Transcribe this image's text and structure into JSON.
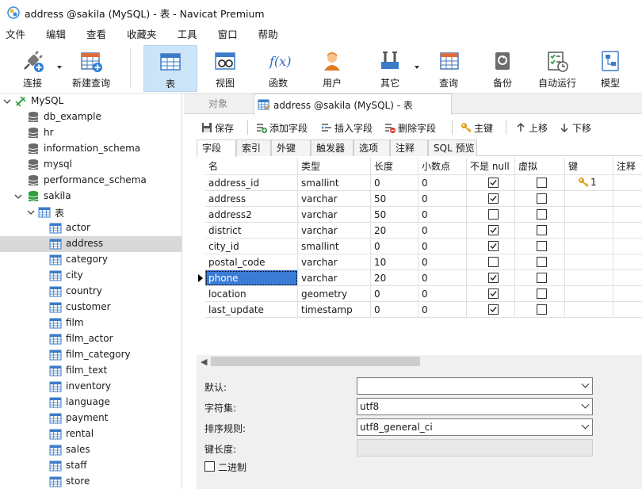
{
  "window": {
    "title": "address @sakila (MySQL) - 表 - Navicat Premium"
  },
  "menu": [
    "文件",
    "编辑",
    "查看",
    "收藏夹",
    "工具",
    "窗口",
    "帮助"
  ],
  "toolbar": {
    "connect": "连接",
    "new_query": "新建查询",
    "table": "表",
    "view": "视图",
    "function": "函数",
    "user": "用户",
    "other": "其它",
    "query": "查询",
    "backup": "备份",
    "automation": "自动运行",
    "model": "模型"
  },
  "tree": {
    "connection": "MySQL",
    "databases": [
      "db_example",
      "hr",
      "information_schema",
      "mysql",
      "performance_schema"
    ],
    "active_db": "sakila",
    "tables_folder": "表",
    "tables": [
      "actor",
      "address",
      "category",
      "city",
      "country",
      "customer",
      "film",
      "film_actor",
      "film_category",
      "film_text",
      "inventory",
      "language",
      "payment",
      "rental",
      "sales",
      "staff",
      "store"
    ],
    "selected_table": "address"
  },
  "tabs": {
    "objects": "对象",
    "document": "address @sakila (MySQL) - 表"
  },
  "designer_toolbar": {
    "save": "保存",
    "add_field": "添加字段",
    "insert_field": "插入字段",
    "delete_field": "删除字段",
    "primary_key": "主键",
    "move_up": "上移",
    "move_down": "下移"
  },
  "subtabs": [
    "字段",
    "索引",
    "外键",
    "触发器",
    "选项",
    "注释",
    "SQL 预览"
  ],
  "grid": {
    "headers": [
      "名",
      "类型",
      "长度",
      "小数点",
      "不是 null",
      "虚拟",
      "键",
      "注释"
    ],
    "rows": [
      {
        "name": "address_id",
        "type": "smallint",
        "length": "0",
        "decimals": "0",
        "not_null": true,
        "virtual": false,
        "key": "1"
      },
      {
        "name": "address",
        "type": "varchar",
        "length": "50",
        "decimals": "0",
        "not_null": true,
        "virtual": false,
        "key": ""
      },
      {
        "name": "address2",
        "type": "varchar",
        "length": "50",
        "decimals": "0",
        "not_null": false,
        "virtual": false,
        "key": ""
      },
      {
        "name": "district",
        "type": "varchar",
        "length": "20",
        "decimals": "0",
        "not_null": true,
        "virtual": false,
        "key": ""
      },
      {
        "name": "city_id",
        "type": "smallint",
        "length": "0",
        "decimals": "0",
        "not_null": true,
        "virtual": false,
        "key": ""
      },
      {
        "name": "postal_code",
        "type": "varchar",
        "length": "10",
        "decimals": "0",
        "not_null": false,
        "virtual": false,
        "key": ""
      },
      {
        "name": "phone",
        "type": "varchar",
        "length": "20",
        "decimals": "0",
        "not_null": true,
        "virtual": false,
        "key": ""
      },
      {
        "name": "location",
        "type": "geometry",
        "length": "0",
        "decimals": "0",
        "not_null": true,
        "virtual": false,
        "key": ""
      },
      {
        "name": "last_update",
        "type": "timestamp",
        "length": "0",
        "decimals": "0",
        "not_null": true,
        "virtual": false,
        "key": ""
      }
    ],
    "selected_row": 6
  },
  "properties": {
    "default_label": "默认:",
    "default_value": "",
    "charset_label": "字符集:",
    "charset_value": "utf8",
    "collation_label": "排序规则:",
    "collation_value": "utf8_general_ci",
    "key_length_label": "键长度:",
    "key_length_value": "",
    "binary_label": "二进制"
  },
  "colors": {
    "accent": "#3a7bd5",
    "toolbar_active": "#cce4f7",
    "db_active": "#2e9e3e"
  }
}
